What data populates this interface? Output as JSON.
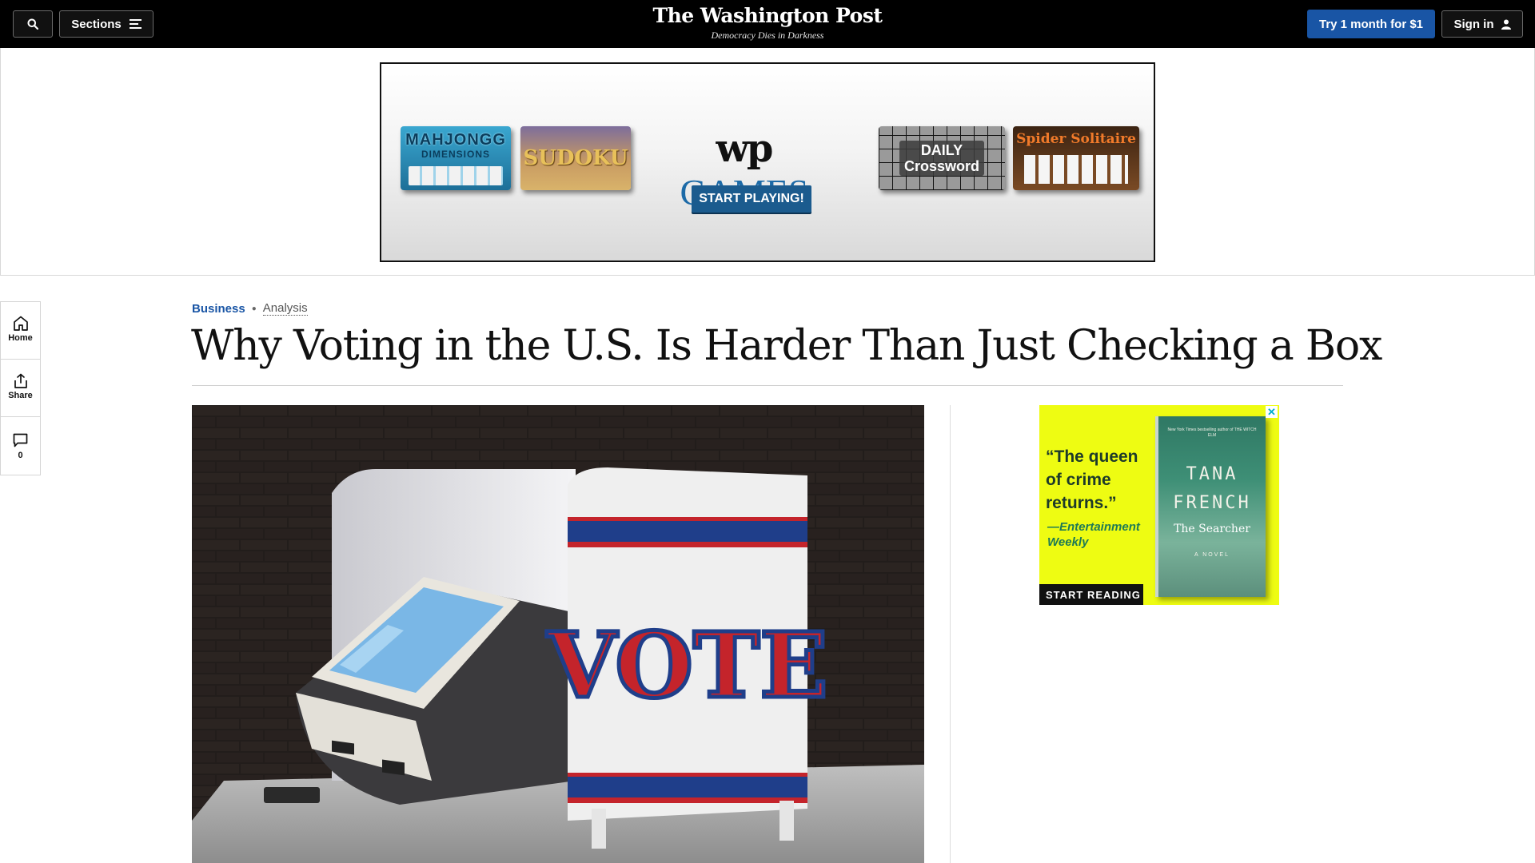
{
  "header": {
    "search_icon": "search-icon",
    "sections_label": "Sections",
    "sections_icon": "menu-icon",
    "logo_text": "The Washington Post",
    "tagline": "Democracy Dies in Darkness",
    "subscribe_label": "Try 1 month for $1",
    "signin_label": "Sign in",
    "signin_icon": "user-icon"
  },
  "top_ad": {
    "tiles": [
      {
        "line1": "MAHJONGG",
        "line2": "DIMENSIONS"
      },
      {
        "line1": "SUDOKU"
      },
      {
        "line1": "DAILY",
        "line2": "Crossword"
      },
      {
        "line1": "Spider Solitaire"
      }
    ],
    "brand_logo": "wp",
    "brand_games": "GAMES",
    "cta": "START PLAYING!"
  },
  "rail": {
    "home": "Home",
    "share": "Share",
    "comments_count": "0"
  },
  "article": {
    "section": "Business",
    "label": "Analysis",
    "headline": "Why Voting in the U.S. Is Harder Than Just Checking a Box",
    "lead_image": {
      "booth_text": "VOTE"
    }
  },
  "side_ad": {
    "quote": "“The queen of crime returns.”",
    "attribution": "—Entertainment Weekly",
    "cta": "START READING",
    "book_author": "TANA FRENCH",
    "book_title": "The Searcher",
    "book_type": "A NOVEL",
    "book_blurb": "New York Times bestselling author of THE WITCH ELM",
    "close_label": "✕"
  },
  "colors": {
    "accent_blue": "#1955a5",
    "header_bg": "#000000",
    "ad_yellow": "#eefc12"
  }
}
